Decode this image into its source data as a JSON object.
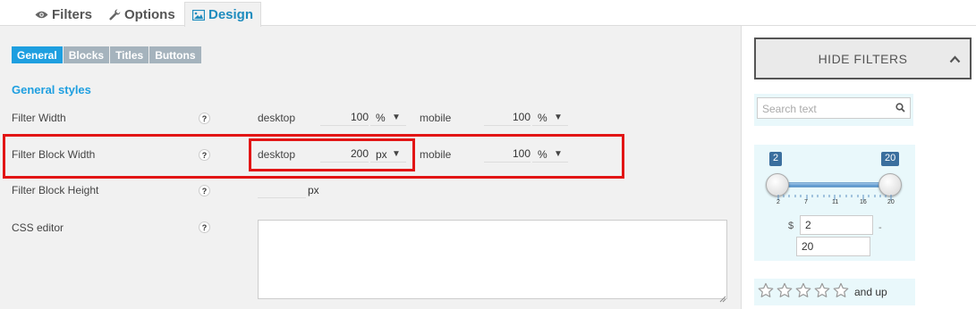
{
  "top_tabs": [
    {
      "label": "Filters",
      "icon": "eye-icon"
    },
    {
      "label": "Options",
      "icon": "wrench-icon"
    },
    {
      "label": "Design",
      "icon": "image-icon",
      "active": true
    }
  ],
  "sub_tabs": [
    {
      "label": "General",
      "active": true
    },
    {
      "label": "Blocks"
    },
    {
      "label": "Titles"
    },
    {
      "label": "Buttons"
    }
  ],
  "section_title": "General styles",
  "help_glyph": "?",
  "rows": {
    "filter_width": {
      "label": "Filter Width",
      "desktop_label": "desktop",
      "desktop_value": "100",
      "desktop_unit": "%",
      "mobile_label": "mobile",
      "mobile_value": "100",
      "mobile_unit": "%"
    },
    "filter_block_width": {
      "label": "Filter Block Width",
      "desktop_label": "desktop",
      "desktop_value": "200",
      "desktop_unit": "px",
      "mobile_label": "mobile",
      "mobile_value": "100",
      "mobile_unit": "%"
    },
    "filter_block_height": {
      "label": "Filter Block Height",
      "value": "",
      "unit": "px"
    },
    "css_editor": {
      "label": "CSS editor",
      "value": ""
    }
  },
  "dropdown_arrow": "▼",
  "sidebar": {
    "hide_filters_label": "HIDE FILTERS",
    "search_placeholder": "Search text",
    "price": {
      "min_badge": "2",
      "max_badge": "20",
      "ticks": [
        "2",
        "7",
        "11",
        "16",
        "20"
      ],
      "currency": "$",
      "min_value": "2",
      "max_value": "20",
      "separator": "-"
    },
    "rating_label": "and up"
  },
  "colors": {
    "accent": "#1e9fe0",
    "highlight_border": "#e21515",
    "slider_badge": "#3b6f9e"
  }
}
